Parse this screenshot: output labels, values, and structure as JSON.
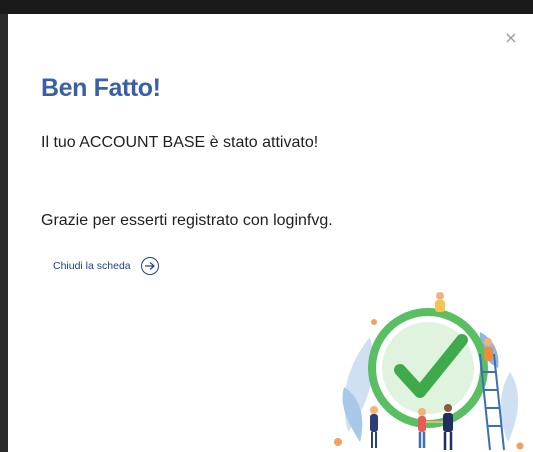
{
  "modal": {
    "close_icon": "close-icon",
    "close_glyph": "×",
    "title": "Ben Fatto!",
    "subtitle": "Il tuo ACCOUNT BASE è stato attivato!",
    "thanks": "Grazie per esserti registrato con loginfvg.",
    "close_link_label": "Chiudi la scheda",
    "close_link_icon": "arrow-right-circle-icon",
    "illustration_icon": "success-checkmark-illustration"
  },
  "colors": {
    "accent": "#3a5fa7",
    "link": "#23408f",
    "check_green": "#4cbf58"
  }
}
